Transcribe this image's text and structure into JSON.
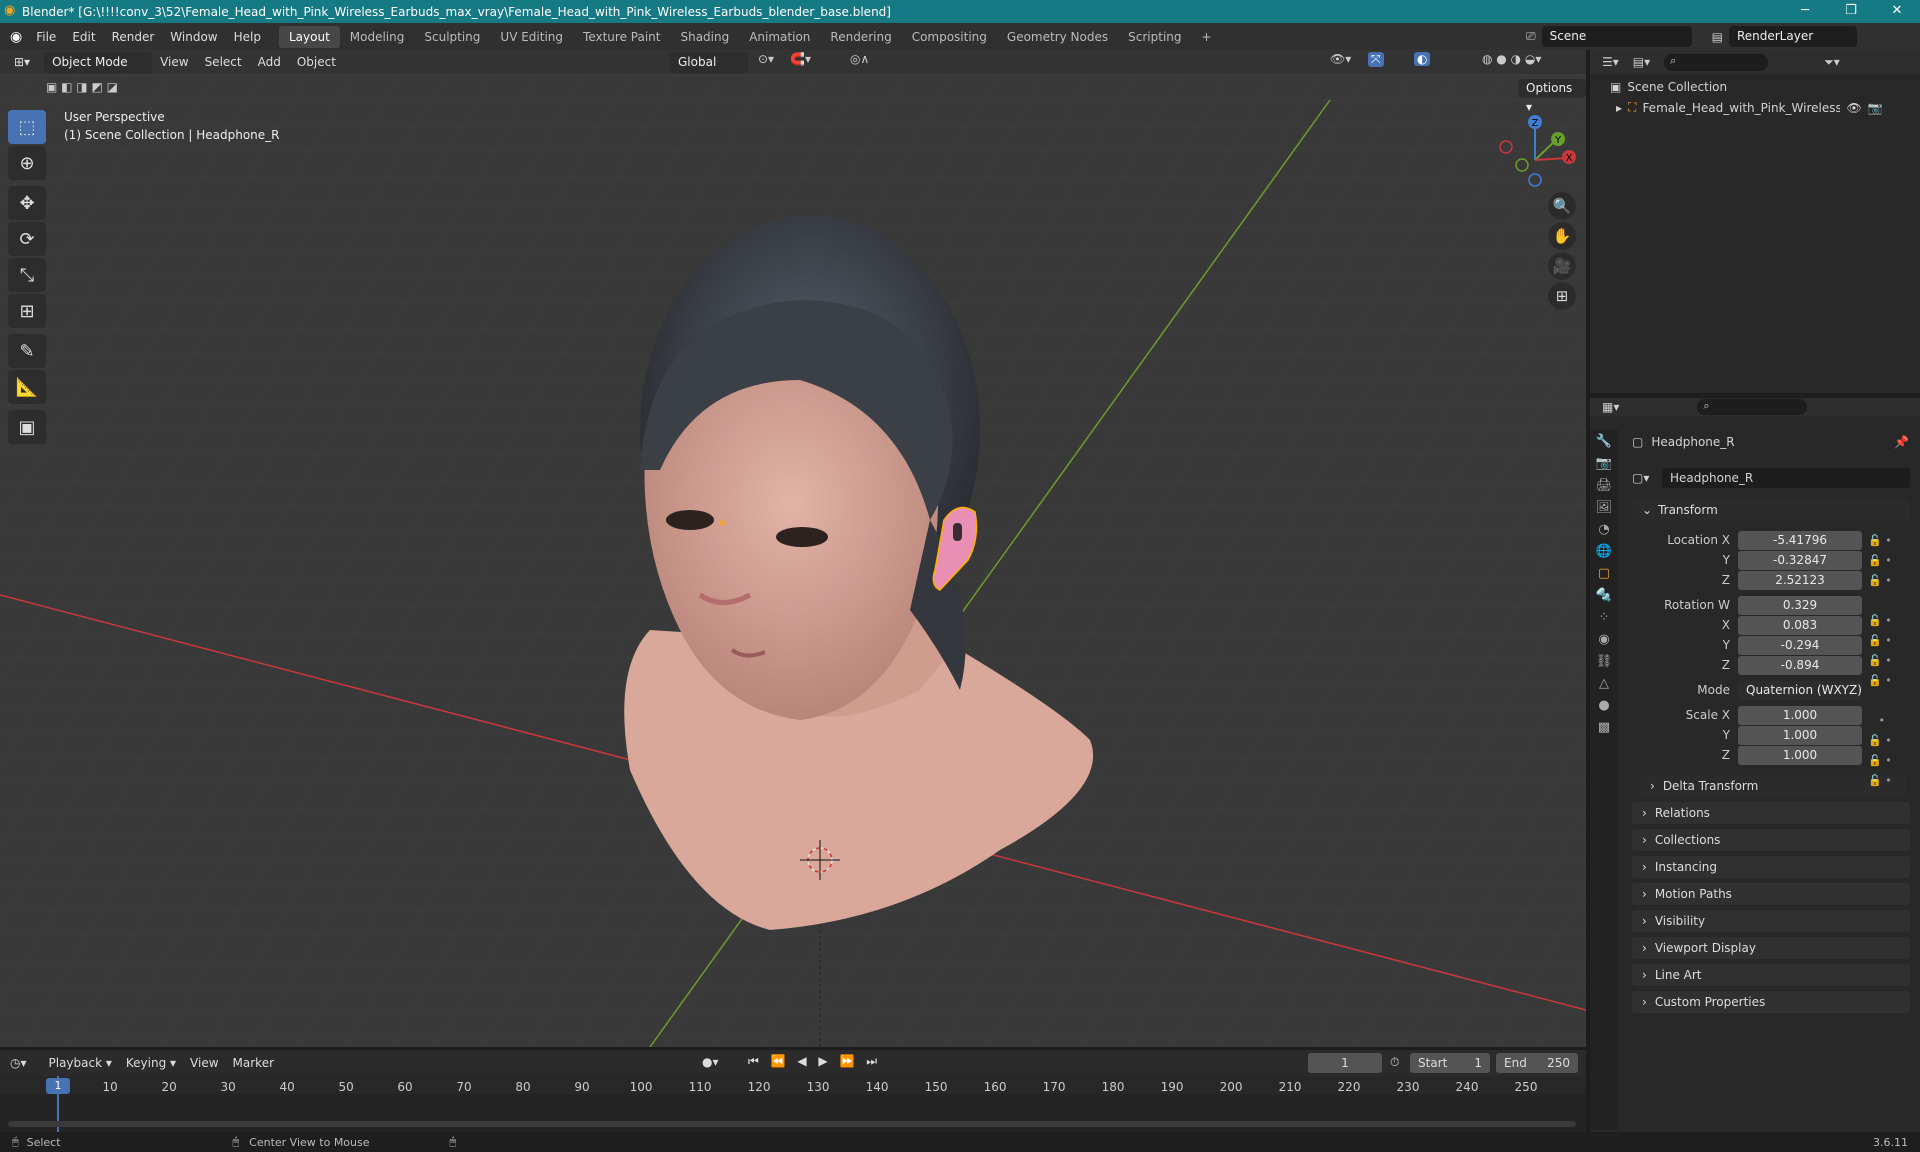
{
  "titlebar": {
    "title": "Blender* [G:\\!!!!conv_3\\52\\Female_Head_with_Pink_Wireless_Earbuds_max_vray\\Female_Head_with_Pink_Wireless_Earbuds_blender_base.blend]",
    "minimize": "─",
    "maximize": "❐",
    "close": "✕"
  },
  "menu": [
    "File",
    "Edit",
    "Render",
    "Window",
    "Help"
  ],
  "workspaces": [
    "Layout",
    "Modeling",
    "Sculpting",
    "UV Editing",
    "Texture Paint",
    "Shading",
    "Animation",
    "Rendering",
    "Compositing",
    "Geometry Nodes",
    "Scripting"
  ],
  "workspace_add": "+",
  "scene": {
    "name": "Scene",
    "render_layer": "RenderLayer"
  },
  "viewport": {
    "mode": "Object Mode",
    "view": "View",
    "select": "Select",
    "add": "Add",
    "object": "Object",
    "orientation": "Global",
    "options": "Options",
    "perspective": "User Perspective",
    "collection_info": "(1) Scene Collection | Headphone_R",
    "gizmo": {
      "z": "Z",
      "y": "Y",
      "x": "X"
    }
  },
  "outliner": {
    "scene_collection": "Scene Collection",
    "item": "Female_Head_with_Pink_Wireless_Earbı"
  },
  "properties": {
    "object_name": "Headphone_R",
    "datablock": "Headphone_R",
    "transform": "Transform",
    "location_label": "Location X",
    "y_label": "Y",
    "z_label": "Z",
    "x_label": "X",
    "w_label": "Rotation W",
    "location": [
      "-5.41796",
      "-0.32847",
      "2.52123"
    ],
    "rotation": [
      "0.329",
      "0.083",
      "-0.294",
      "-0.894"
    ],
    "mode_label": "Mode",
    "mode_value": "Quaternion (WXYZ)",
    "scale_label": "Scale X",
    "scale": [
      "1.000",
      "1.000",
      "1.000"
    ],
    "delta": "Delta Transform",
    "panels": [
      "Relations",
      "Collections",
      "Instancing",
      "Motion Paths",
      "Visibility",
      "Viewport Display",
      "Line Art",
      "Custom Properties"
    ]
  },
  "timeline": {
    "playback": "Playback",
    "keying": "Keying",
    "view": "View",
    "marker": "Marker",
    "current_frame": "1",
    "start_label": "Start",
    "start": "1",
    "end_label": "End",
    "end": "250",
    "ticks": [
      "1",
      "10",
      "20",
      "30",
      "40",
      "50",
      "60",
      "70",
      "80",
      "90",
      "100",
      "110",
      "120",
      "130",
      "140",
      "150",
      "160",
      "170",
      "180",
      "190",
      "200",
      "210",
      "220",
      "230",
      "240",
      "250"
    ]
  },
  "status": {
    "select": "Select",
    "center": "Center View to Mouse",
    "version": "3.6.11"
  },
  "colors": {
    "accent": "#4772b3",
    "titlebar": "#167a85",
    "x_axis": "#c8383c",
    "y_axis": "#6a9e2a",
    "earbud": "#ea8fb4"
  }
}
